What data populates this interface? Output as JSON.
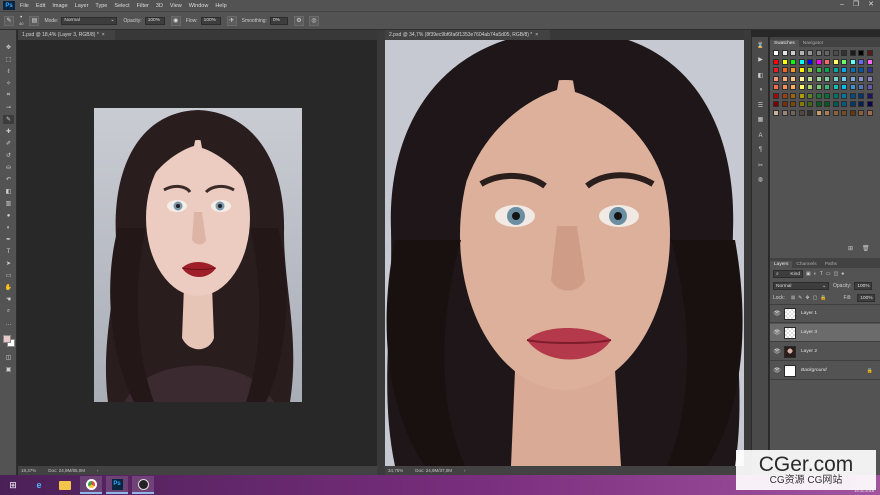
{
  "app": {
    "logo_text": "Ps"
  },
  "menu": [
    "File",
    "Edit",
    "Image",
    "Layer",
    "Type",
    "Select",
    "Filter",
    "3D",
    "View",
    "Window",
    "Help"
  ],
  "options": {
    "brush_size": "40",
    "mode_label": "Mode:",
    "mode_value": "Normal",
    "opacity_label": "Opacity:",
    "opacity_value": "100%",
    "flow_label": "Flow:",
    "flow_value": "100%",
    "smoothing_label": "Smoothing:",
    "smoothing_value": "0%"
  },
  "documents": [
    {
      "tab": "1.psd @ 18,4% (Layer 3, RGB/8) *",
      "zoom": "18,37%",
      "doc": "Doc: 24,9M/85,0M"
    },
    {
      "tab": "2.psd @ 34,7% (8f39ec9bf6fa6f1353e7604ab74a5d05, RGB/8) *",
      "zoom": "34,75%",
      "doc": "Doc: 24,9M/37,0M"
    }
  ],
  "panels": {
    "swatch_tabs": [
      "Swatches",
      "Navigator"
    ],
    "layers_tabs": [
      "Layers",
      "Channels",
      "Paths"
    ],
    "kind_label": "Kind",
    "blend_mode": "Normal",
    "opacity_label": "Opacity:",
    "opacity_value": "100%",
    "lock_label": "Lock:",
    "fill_label": "Fill:",
    "fill_value": "100%",
    "layers": [
      {
        "name": "Layer 1",
        "selected": false,
        "thumb": "transparent"
      },
      {
        "name": "Layer 3",
        "selected": true,
        "thumb": "transparent"
      },
      {
        "name": "Layer 2",
        "selected": false,
        "thumb": "portrait"
      },
      {
        "name": "Background",
        "selected": false,
        "thumb": "white"
      }
    ]
  },
  "swatch_colors": [
    "#ffffff",
    "#e6e6e6",
    "#cccccc",
    "#b3b3b3",
    "#999999",
    "#808080",
    "#666666",
    "#4d4d4d",
    "#333333",
    "#1a1a1a",
    "#000000",
    "#5a1a1a",
    "#ff0000",
    "#ffff00",
    "#00ff00",
    "#00ffff",
    "#0000ff",
    "#ff00ff",
    "#ff6666",
    "#ffff66",
    "#66ff66",
    "#66ffff",
    "#6666ff",
    "#ff66ff",
    "#ed1c24",
    "#f26522",
    "#f7941d",
    "#fff200",
    "#8dc63f",
    "#39b54a",
    "#00a651",
    "#00a99d",
    "#00aeef",
    "#0072bc",
    "#0054a6",
    "#2e3192",
    "#f69679",
    "#f9ad81",
    "#fdc689",
    "#fff799",
    "#c4df9b",
    "#a3d39c",
    "#82ca9c",
    "#7accc8",
    "#6dcff6",
    "#7da7d9",
    "#8393ca",
    "#8781bd",
    "#f26c4f",
    "#f68e56",
    "#fbaf5d",
    "#fff568",
    "#acd372",
    "#7cc576",
    "#3bb878",
    "#1abbb4",
    "#00bff3",
    "#448ccb",
    "#5574b9",
    "#605ca8",
    "#9e0b0f",
    "#a0410d",
    "#a36209",
    "#aba000",
    "#598527",
    "#1a7b30",
    "#007236",
    "#00746b",
    "#0076a3",
    "#004b80",
    "#003471",
    "#1b1464",
    "#790000",
    "#7b2e00",
    "#7d4900",
    "#827b00",
    "#406618",
    "#005e20",
    "#005826",
    "#005952",
    "#005b7f",
    "#003663",
    "#002157",
    "#0d004c",
    "#c7b299",
    "#998675",
    "#736357",
    "#534741",
    "#362f2d",
    "#c69c6d",
    "#a67c52",
    "#8c6239",
    "#754c24",
    "#603913",
    "#8b5e3c",
    "#a5674f"
  ],
  "taskbar": {
    "apps": [
      "start-icon",
      "ie-icon",
      "folder-icon",
      "chrome-icon",
      "photoshop-icon",
      "obs-icon"
    ],
    "clock": "15.11.2018"
  },
  "watermark": {
    "brand": "CGer.com",
    "sub": "CG资源 CG网站"
  }
}
